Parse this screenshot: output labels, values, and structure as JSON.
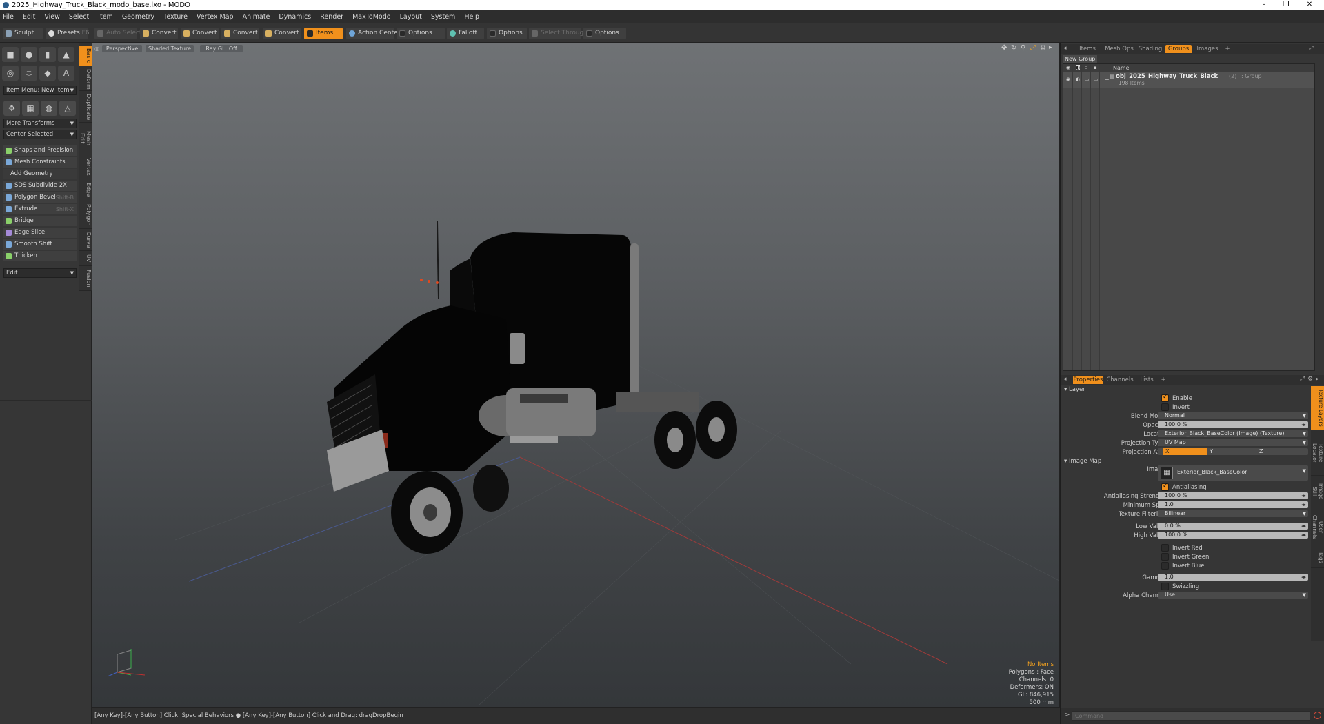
{
  "window": {
    "title": "2025_Highway_Truck_Black_modo_base.lxo - MODO",
    "minimize": "–",
    "maximize": "❐",
    "close": "✕"
  },
  "menu": [
    "File",
    "Edit",
    "View",
    "Select",
    "Item",
    "Geometry",
    "Texture",
    "Vertex Map",
    "Animate",
    "Dynamics",
    "Render",
    "MaxToModo",
    "Layout",
    "System",
    "Help"
  ],
  "toolbar": {
    "sculpt": "Sculpt",
    "presets": "Presets",
    "presets_key": "F6",
    "auto_select": "Auto Select",
    "convert": "Convert",
    "items": "Items",
    "action_center": "Action Center",
    "options": "Options",
    "falloff": "Falloff",
    "select_through": "Select Through"
  },
  "left_tabs": [
    "Basic",
    "Deform",
    "Duplicate",
    "Mesh Edit",
    "Vertex",
    "Edge",
    "Polygon",
    "Curve",
    "UV",
    "Fusion"
  ],
  "left_panel": {
    "item_menu": "Item Menu: New Item",
    "more_transforms": "More Transforms",
    "center_selected": "Center Selected",
    "snaps": "Snaps and Precision",
    "mesh_constraints": "Mesh Constraints",
    "add_geometry": "Add Geometry",
    "tools": [
      {
        "label": "SDS Subdivide 2X",
        "shortcut": ""
      },
      {
        "label": "Polygon Bevel",
        "shortcut": "Shift-B"
      },
      {
        "label": "Extrude",
        "shortcut": "Shift-X"
      },
      {
        "label": "Bridge",
        "shortcut": ""
      },
      {
        "label": "Edge Slice",
        "shortcut": ""
      },
      {
        "label": "Smooth Shift",
        "shortcut": ""
      },
      {
        "label": "Thicken",
        "shortcut": ""
      }
    ],
    "edit": "Edit"
  },
  "viewport": {
    "view": "Perspective",
    "shading": "Shaded Texture",
    "raygl": "Ray GL: Off",
    "hud": {
      "selection": "No Items",
      "polygons": "Polygons : Face",
      "channels": "Channels: 0",
      "deformers": "Deformers: ON",
      "gl": "GL: 846,915",
      "scale": "500 mm"
    }
  },
  "status": "[Any Key]-[Any Button] Click: Special Behaviors ● [Any Key]-[Any Button] Click and Drag: dragDropBegin",
  "right_top_tabs": [
    "Items",
    "Mesh Ops",
    "Shading",
    "Groups",
    "Images",
    "+"
  ],
  "groups": {
    "new_group": "New Group",
    "name_header": "Name",
    "item_name": "obj_2025_Highway_Truck_Black",
    "item_count": "(2)",
    "item_type": ": Group",
    "item_sub": "198 Items"
  },
  "right_bottom_tabs": [
    "Properties",
    "Channels",
    "Lists",
    "+"
  ],
  "right_side_tabs": [
    "Texture Layers",
    "Texture Locator",
    "Image Still",
    "User Channels",
    "Tags"
  ],
  "properties": {
    "layer_section": "Layer",
    "enable": "Enable",
    "invert": "Invert",
    "blend_mode_label": "Blend Mode",
    "blend_mode": "Normal",
    "opacity_label": "Opacity",
    "opacity": "100.0 %",
    "locator_label": "Locator",
    "locator": "Exterior_Black_BaseColor (Image) (Texture)",
    "projection_type_label": "Projection Type",
    "projection_type": "UV Map",
    "projection_axis_label": "Projection Axis",
    "axis_x": "X",
    "axis_y": "Y",
    "axis_z": "Z",
    "image_map_section": "Image Map",
    "image_label": "Image",
    "image": "Exterior_Black_BaseColor",
    "antialiasing": "Antialiasing",
    "aa_strength_label": "Antialiasing Strength",
    "aa_strength": "100.0 %",
    "min_spot_label": "Minimum Spot",
    "min_spot": "1.0",
    "tex_filter_label": "Texture Filtering",
    "tex_filter": "Bilinear",
    "low_value_label": "Low Value",
    "low_value": "0.0 %",
    "high_value_label": "High Value",
    "high_value": "100.0 %",
    "invert_red": "Invert Red",
    "invert_green": "Invert Green",
    "invert_blue": "Invert Blue",
    "gamma_label": "Gamma",
    "gamma": "1.0",
    "swizzling": "Swizzling",
    "alpha_channel_label": "Alpha Channel",
    "alpha_channel": "Use"
  },
  "command": {
    "placeholder": "Command",
    "prompt": ">"
  },
  "colors": {
    "accent": "#f0901c",
    "panel": "#363636",
    "viewport_top": "#6f7275"
  }
}
